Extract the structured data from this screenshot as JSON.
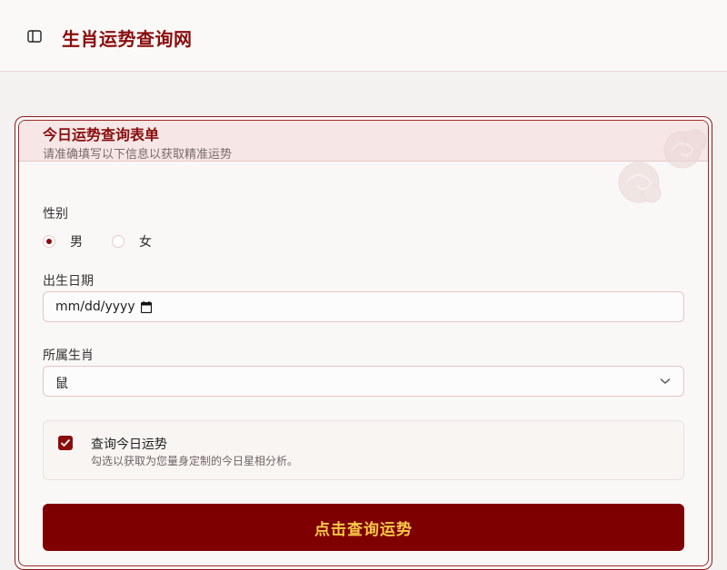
{
  "header": {
    "toggle_icon": "sidebar-toggle-icon",
    "site_title": "生肖运势查询网"
  },
  "form": {
    "title": "今日运势查询表单",
    "subtitle": "请准确填写以下信息以获取精准运势",
    "gender": {
      "label": "性别",
      "options": [
        {
          "label": "男",
          "selected": true
        },
        {
          "label": "女",
          "selected": false
        }
      ]
    },
    "birth_date": {
      "label": "出生日期",
      "placeholder": "mm/dd/yyyy",
      "icon": "calendar-icon"
    },
    "zodiac": {
      "label": "所属生肖",
      "selected": "鼠",
      "icon": "chevron-down-icon"
    },
    "daily_check": {
      "checked": true,
      "title": "查询今日运势",
      "description": "勾选以获取为您量身定制的今日星相分析。"
    },
    "submit_label": "点击查询运势"
  },
  "colors": {
    "primary": "#7f0000",
    "accent_text": "#f7c948",
    "header_bg": "#f6e6e6",
    "page_bg": "#f4f2f0"
  }
}
